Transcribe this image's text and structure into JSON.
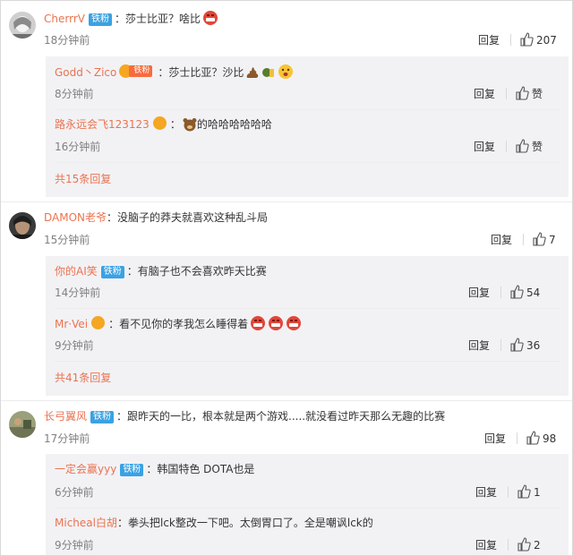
{
  "comments": [
    {
      "user": "CherrrV",
      "badge": "铁粉",
      "text": "莎士比亚？啥比",
      "time": "18分钟前",
      "reply_label": "回复",
      "likes": "207",
      "replies": [
        {
          "user": "Godd丶Zico",
          "vip_label": "铁粉",
          "text": "莎士比亚？沙比",
          "time": "8分钟前",
          "reply_label": "回复",
          "likes": "赞"
        },
        {
          "user": "路永远会飞123123",
          "text": "的哈哈哈哈哈哈",
          "time": "16分钟前",
          "reply_label": "回复",
          "likes": "赞"
        }
      ],
      "more": "共15条回复"
    },
    {
      "user": "DAMON老爷",
      "text": "没脑子的莽夫就喜欢这种乱斗局",
      "time": "15分钟前",
      "reply_label": "回复",
      "likes": "7",
      "replies": [
        {
          "user": "你的AI笑",
          "badge": "铁粉",
          "text": "有脑子也不会喜欢昨天比赛",
          "time": "14分钟前",
          "reply_label": "回复",
          "likes": "54"
        },
        {
          "user": "Mr·Vei",
          "text": "看不见你的孝我怎么睡得着",
          "time": "9分钟前",
          "reply_label": "回复",
          "likes": "36"
        }
      ],
      "more": "共41条回复"
    },
    {
      "user": "长弓翼风",
      "badge": "铁粉",
      "text": "跟昨天的一比，根本就是两个游戏.....就没看过昨天那么无趣的比赛",
      "time": "17分钟前",
      "reply_label": "回复",
      "likes": "98",
      "replies": [
        {
          "user": "一定会赢yyy",
          "badge": "铁粉",
          "text": "韩国特色 DOTA也是",
          "time": "6分钟前",
          "reply_label": "回复",
          "likes": "1"
        },
        {
          "user": "Micheal白胡",
          "text": "拳头把lck整改一下吧。太倒胃口了。全是嘲讽lck的",
          "time": "9分钟前",
          "reply_label": "回复",
          "likes": "2"
        }
      ]
    }
  ],
  "colors": {
    "username": "#eb7350",
    "badge": "#3aa2e3",
    "reply_bg": "#f2f2f5",
    "time": "#808080"
  }
}
